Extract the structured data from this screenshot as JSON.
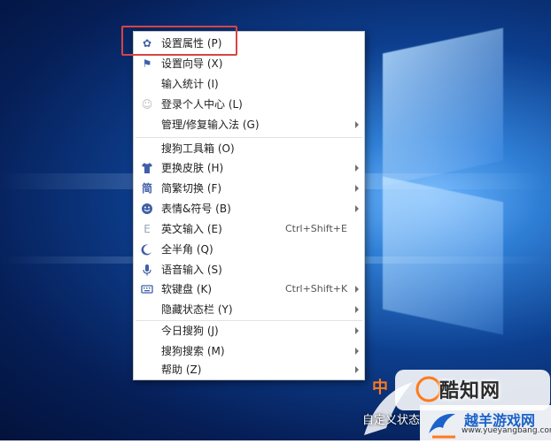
{
  "menu": {
    "items": [
      {
        "label": "设置属性 (P)",
        "icon": "gear-icon",
        "glyph": "✿",
        "shortcut": "",
        "submenu": false
      },
      {
        "label": "设置向导 (X)",
        "icon": "flag-icon",
        "glyph": "⚑",
        "shortcut": "",
        "submenu": false
      },
      {
        "label": "输入统计 (I)",
        "icon": "",
        "glyph": "",
        "shortcut": "",
        "submenu": false
      },
      {
        "label": "登录个人中心 (L)",
        "icon": "user-icon",
        "glyph": "☺",
        "shortcut": "",
        "submenu": false
      },
      {
        "label": "管理/修复输入法 (G)",
        "icon": "",
        "glyph": "",
        "shortcut": "",
        "submenu": true
      },
      {
        "label": "搜狗工具箱 (O)",
        "icon": "",
        "glyph": "",
        "shortcut": "",
        "submenu": false
      },
      {
        "label": "更换皮肤 (H)",
        "icon": "shirt-icon",
        "glyph": "👕",
        "shortcut": "",
        "submenu": true
      },
      {
        "label": "简繁切换 (F)",
        "icon": "simplified-traditional-icon",
        "glyph": "简",
        "shortcut": "",
        "submenu": true
      },
      {
        "label": "表情&符号 (B)",
        "icon": "smiley-icon",
        "glyph": "☺",
        "shortcut": "",
        "submenu": true
      },
      {
        "label": "英文输入 (E)",
        "icon": "english-icon",
        "glyph": "E",
        "shortcut": "Ctrl+Shift+E",
        "submenu": false
      },
      {
        "label": "全半角 (Q)",
        "icon": "moon-icon",
        "glyph": "☽",
        "shortcut": "",
        "submenu": false
      },
      {
        "label": "语音输入 (S)",
        "icon": "microphone-icon",
        "glyph": "🎤",
        "shortcut": "",
        "submenu": false
      },
      {
        "label": "软键盘 (K)",
        "icon": "keyboard-icon",
        "glyph": "⌨",
        "shortcut": "Ctrl+Shift+K",
        "submenu": true
      },
      {
        "label": "隐藏状态栏 (Y)",
        "icon": "",
        "glyph": "",
        "shortcut": "",
        "submenu": true
      },
      {
        "label": "今日搜狗 (J)",
        "icon": "",
        "glyph": "",
        "shortcut": "",
        "submenu": true
      },
      {
        "label": "搜狗搜索 (M)",
        "icon": "",
        "glyph": "",
        "shortcut": "",
        "submenu": true
      },
      {
        "label": "帮助 (Z)",
        "icon": "",
        "glyph": "",
        "shortcut": "",
        "submenu": true
      }
    ]
  },
  "watermark": {
    "cn_text": "中",
    "sub_text": "自定义状态",
    "logo_text": "酷知网",
    "brand_text": "越羊游戏网",
    "url_text": "www.yueyangbang.com"
  },
  "colors": {
    "highlight_border": "#d64543",
    "icon_blue": "#3f5fa8",
    "brand_blue": "#1b62c9",
    "accent_orange": "#ff7a1a"
  }
}
